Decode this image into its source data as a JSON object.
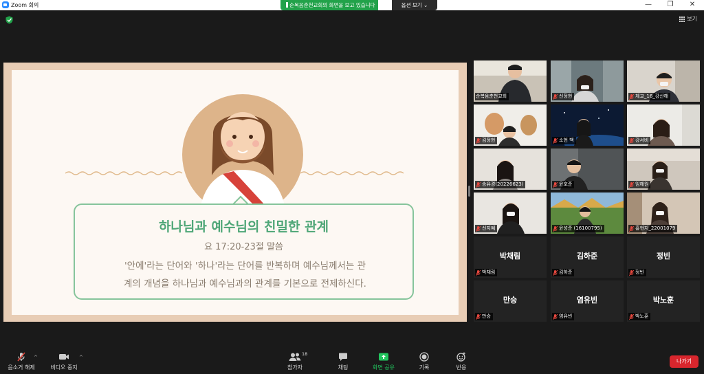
{
  "window": {
    "title": "Zoom 회의",
    "minimize": "—",
    "maximize": "❐",
    "close": "✕"
  },
  "banner": {
    "text": "순복음춘천교회의 화면을 보고 있습니다",
    "view_options": "옵션 보기 ⌄"
  },
  "view_toggle": {
    "label": "보기"
  },
  "slide": {
    "title": "하나님과 예수님의 친밀한 관계",
    "subtitle": "요 17:20-23절 말씀",
    "body_line1": "'안에'라는 단어와 '하나'라는 단어를 반복하며 예수님께서는 관",
    "body_line2": "계의 개념을 하나님과 예수님과의 관계를 기본으로 전제하신다."
  },
  "participants": [
    {
      "name": "순복음춘천교회",
      "muted": false,
      "video": true,
      "active": true
    },
    {
      "name": "신정현",
      "muted": true,
      "video": true
    },
    {
      "name": "체교_16_강산해",
      "muted": true,
      "video": true
    },
    {
      "name": "김정현",
      "muted": true,
      "video": true
    },
    {
      "name": "소현 백",
      "muted": true,
      "video": true
    },
    {
      "name": "강서비",
      "muted": true,
      "video": true
    },
    {
      "name": "송유경(20226623)",
      "muted": true,
      "video": true
    },
    {
      "name": "윤호준",
      "muted": true,
      "video": true
    },
    {
      "name": "임해원",
      "muted": true,
      "video": true
    },
    {
      "name": "신지예",
      "muted": true,
      "video": true
    },
    {
      "name": "윤성준 (16100795)",
      "muted": true,
      "video": true
    },
    {
      "name": "홍현지_22001079",
      "muted": true,
      "video": true
    },
    {
      "name": "박채림",
      "muted": true,
      "video": false
    },
    {
      "name": "김하준",
      "muted": true,
      "video": false
    },
    {
      "name": "정빈",
      "muted": true,
      "video": false
    },
    {
      "name": "만승",
      "muted": true,
      "video": false
    },
    {
      "name": "염유빈",
      "muted": true,
      "video": false
    },
    {
      "name": "박노훈",
      "muted": true,
      "video": false
    }
  ],
  "toolbar": {
    "unmute": "음소거 해제",
    "video": "비디오 중지",
    "participants": "참가자",
    "participant_count": "18",
    "chat": "채팅",
    "share": "화면 공유",
    "record": "기록",
    "reactions": "반응",
    "leave": "나가기"
  },
  "colors": {
    "share_green": "#22a24a",
    "slide_green": "#4ea677",
    "leave_red": "#d8262d",
    "active_speaker": "#c7e84a"
  }
}
